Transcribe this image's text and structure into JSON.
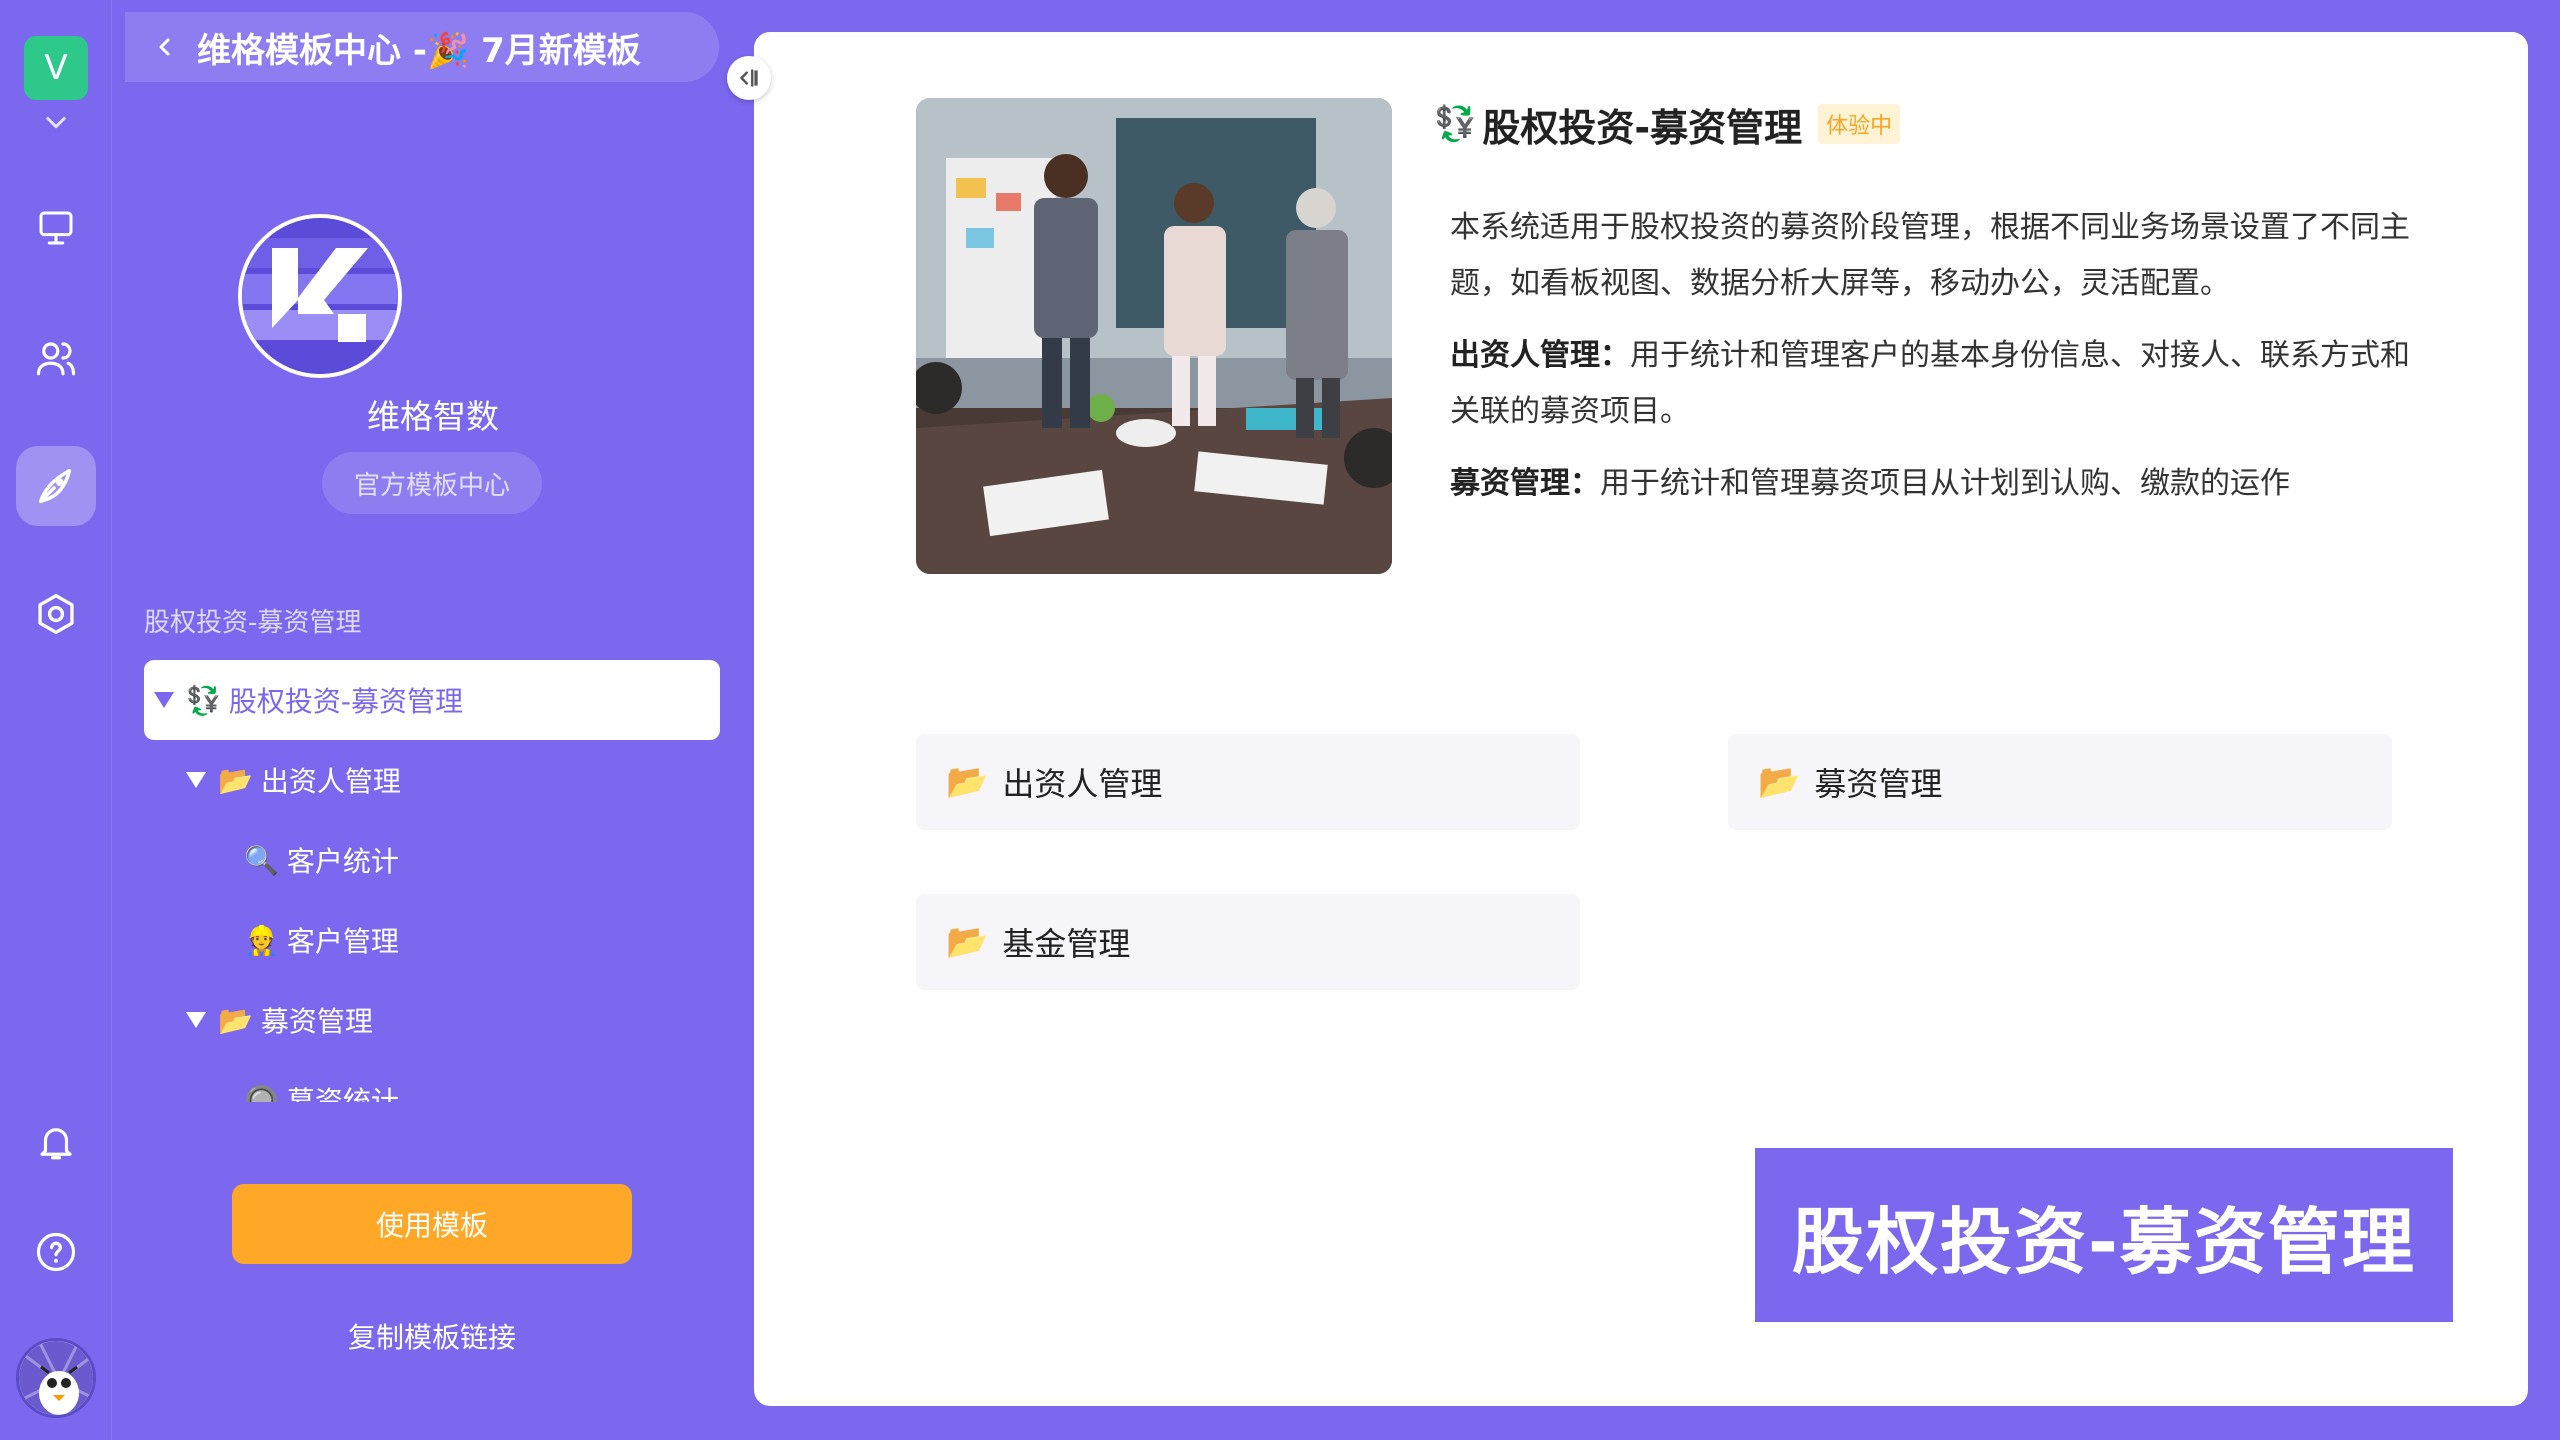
{
  "rail": {
    "space_initial": "V",
    "items": [
      "desktop-icon",
      "people-icon",
      "template-center-icon",
      "settings-hex-icon",
      "bell-icon",
      "help-icon"
    ],
    "active": "template-center-icon"
  },
  "sidebar": {
    "header_title": "维格模板中心 -🎉 7月新模板",
    "org_name": "维格智数",
    "org_tag": "官方模板中心",
    "section_label": "股权投资-募资管理",
    "tree": [
      {
        "icon": "💱",
        "label": "股权投资-募资管理",
        "level": 0,
        "expanded": true,
        "selected": true
      },
      {
        "icon": "📂",
        "label": "出资人管理",
        "level": 1,
        "expanded": true
      },
      {
        "icon": "🔍",
        "label": "客户统计",
        "level": 2
      },
      {
        "icon": "👷",
        "label": "客户管理",
        "level": 2
      },
      {
        "icon": "📂",
        "label": "募资管理",
        "level": 1,
        "expanded": true
      },
      {
        "icon": "🔘",
        "label": "募资统计",
        "level": 2
      }
    ],
    "use_button": "使用模板",
    "copy_link": "复制模板链接"
  },
  "main": {
    "title_icon": "💱",
    "title": "股权投资-募资管理",
    "badge": "体验中",
    "desc_intro": "本系统适用于股权投资的募资阶段管理，根据不同业务场景设置了不同主题，如看板视图、数据分析大屏等，移动办公，灵活配置。",
    "desc_items": [
      {
        "label": "出资人管理",
        "text": "用于统计和管理客户的基本身份信息、对接人、联系方式和关联的募资项目。"
      },
      {
        "label": "募资管理",
        "text": "用于统计和管理募资项目从计划到认购、缴款的运作"
      }
    ],
    "folders": [
      {
        "icon": "📂",
        "label": "出资人管理"
      },
      {
        "icon": "📂",
        "label": "募资管理"
      },
      {
        "icon": "📂",
        "label": "基金管理"
      }
    ],
    "banner": "股权投资-募资管理"
  },
  "colors": {
    "brand": "#7B68EE",
    "space_badge": "#2DC88A",
    "use_button": "#FFA726",
    "badge_bg": "#FFF3D6",
    "badge_text": "#F5A623"
  }
}
